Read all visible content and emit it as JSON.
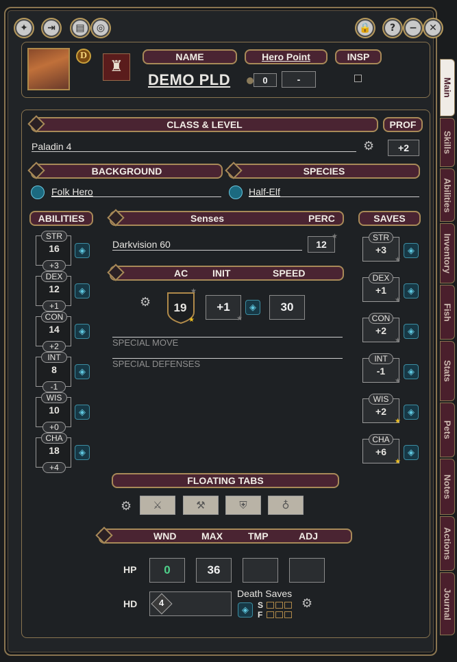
{
  "character": {
    "name_label": "NAME",
    "name": "DEMO PLD",
    "hero_point_label": "Hero Point",
    "hero_point_value": "0",
    "hero_point_extra": "-",
    "insp_label": "INSP",
    "d_badge": "D"
  },
  "class_level": {
    "label": "CLASS & LEVEL",
    "value": "Paladin 4",
    "prof_label": "PROF",
    "prof_value": "+2"
  },
  "background": {
    "label": "BACKGROUND",
    "value": "Folk Hero"
  },
  "species": {
    "label": "SPECIES",
    "value": "Half-Elf"
  },
  "abilities": {
    "label": "ABILITIES",
    "items": [
      {
        "name": "STR",
        "score": "16",
        "mod": "+3"
      },
      {
        "name": "DEX",
        "score": "12",
        "mod": "+1"
      },
      {
        "name": "CON",
        "score": "14",
        "mod": "+2"
      },
      {
        "name": "INT",
        "score": "8",
        "mod": "-1"
      },
      {
        "name": "WIS",
        "score": "10",
        "mod": "+0"
      },
      {
        "name": "CHA",
        "score": "18",
        "mod": "+4"
      }
    ]
  },
  "senses": {
    "label": "Senses",
    "perc_label": "PERC",
    "value": "Darkvision 60",
    "perc_value": "12"
  },
  "combat": {
    "ac_label": "AC",
    "init_label": "INIT",
    "speed_label": "SPEED",
    "ac": "19",
    "init": "+1",
    "speed": "30",
    "special_move": "SPECIAL MOVE",
    "special_defenses": "SPECIAL DEFENSES"
  },
  "saves": {
    "label": "SAVES",
    "items": [
      {
        "name": "STR",
        "value": "+3",
        "proficient": false
      },
      {
        "name": "DEX",
        "value": "+1",
        "proficient": false
      },
      {
        "name": "CON",
        "value": "+2",
        "proficient": false
      },
      {
        "name": "INT",
        "value": "-1",
        "proficient": false
      },
      {
        "name": "WIS",
        "value": "+2",
        "proficient": true
      },
      {
        "name": "CHA",
        "value": "+6",
        "proficient": true
      }
    ]
  },
  "floating_tabs": {
    "label": "FLOATING TABS"
  },
  "health": {
    "wnd_label": "WND",
    "max_label": "MAX",
    "tmp_label": "TMP",
    "adj_label": "ADJ",
    "hp_label": "HP",
    "wnd": "0",
    "max": "36",
    "tmp": "",
    "adj": "",
    "hd_label": "HD",
    "hd_dice": "4",
    "death_saves_label": "Death Saves",
    "success_label": "S",
    "fail_label": "F"
  },
  "side_tabs": [
    "Main",
    "Skills",
    "Abilities",
    "Inventory",
    "Fish",
    "Stats",
    "Pets",
    "Notes",
    "Actions",
    "Journal"
  ],
  "colors": {
    "header_bg": "#4a2432",
    "accent_gold": "#a88a58",
    "dice_teal": "#5fc7df",
    "wnd_green": "#4fd18b"
  }
}
